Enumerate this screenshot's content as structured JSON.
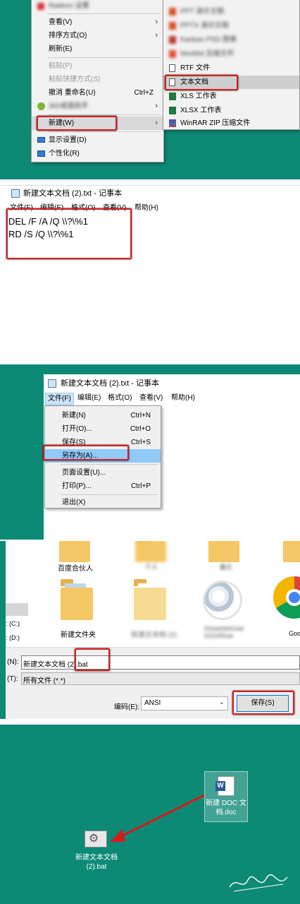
{
  "panel1": {
    "top_item": "Radeon 设置",
    "context_menu": [
      {
        "label": "查看(V)",
        "arrow": "›"
      },
      {
        "label": "排序方式(O)",
        "arrow": "›"
      },
      {
        "label": "刷新(E)"
      },
      {
        "label": "粘贴(P)",
        "disabled": true
      },
      {
        "label": "粘贴快捷方式(S)",
        "disabled": true
      },
      {
        "label": "撤消 重命名(U)",
        "shortcut": "Ctrl+Z"
      },
      {
        "label": "360桌面助手",
        "arrow": "›"
      },
      {
        "label": "新建(W)",
        "arrow": "›"
      },
      {
        "label": "显示设置(D)"
      },
      {
        "label": "个性化(R)"
      }
    ],
    "submenu": [
      "PPT 演示文稿",
      "PPTX 演示文稿",
      "Kankan PSD 图像",
      "Workbit 压缩文件",
      "RTF 文件",
      "文本文档",
      "XLS 工作表",
      "XLSX 工作表",
      "WinRAR ZIP 压缩文件"
    ]
  },
  "panel2": {
    "title": "新建文本文档 (2).txt - 记事本",
    "menu": [
      "文件(F)",
      "编辑(E)",
      "格式(O)",
      "查看(V)",
      "帮助(H)"
    ],
    "lines": [
      "DEL /F /A /Q \\\\?\\%1",
      "RD /S /Q \\\\?\\%1"
    ]
  },
  "panel3": {
    "title": "新建文本文档 (2).txt - 记事本",
    "menu": [
      "文件(F)",
      "编辑(E)",
      "格式(O)",
      "查看(V)",
      "帮助(H)"
    ],
    "file_menu": [
      {
        "label": "新建(N)",
        "shortcut": "Ctrl+N"
      },
      {
        "label": "打开(O)...",
        "shortcut": "Ctrl+O"
      },
      {
        "label": "保存(S)",
        "shortcut": "Ctrl+S"
      },
      {
        "label": "另存为(A)...",
        "shortcut": ""
      },
      {
        "label": "页面设置(U)...",
        "shortcut": ""
      },
      {
        "label": "打印(P)...",
        "shortcut": "Ctrl+P"
      },
      {
        "label": "退出(X)",
        "shortcut": ""
      }
    ]
  },
  "panel4": {
    "top_labels": [
      "百度合伙人",
      "个人",
      "备忘"
    ],
    "files": [
      "新建文件夹",
      "新建文本档 (2)",
      "5f16a62b5f14af61102f91ae",
      "Goo"
    ],
    "drives": [
      ": (C:)",
      ": (D:)"
    ],
    "filename_label": "(N):",
    "filename_value": "新建文本文档 (2).bat",
    "type_label": "(T):",
    "type_value": "所有文件  (*.*)",
    "encoding_label": "编码(E):",
    "encoding_value": "ANSI",
    "save_button": "保存(S)"
  },
  "panel5": {
    "doc_icon_label": "新建 DOC 文档.doc",
    "bat_icon_label": "新建文本文档 (2).bat",
    "signature": "大沛博客"
  }
}
